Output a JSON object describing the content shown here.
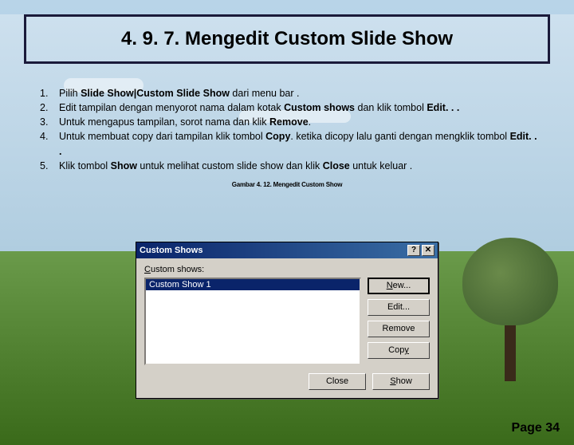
{
  "title": "4. 9. 7. Mengedit Custom Slide Show",
  "bullets": [
    {
      "num": "1.",
      "parts": [
        "Pilih ",
        "Slide Show|Custom Slide Show",
        " dari menu bar ."
      ]
    },
    {
      "num": "2.",
      "parts": [
        "Edit tampilan dengan menyorot nama dalam kotak ",
        "Custom shows",
        " dan klik tombol ",
        "Edit. . ."
      ]
    },
    {
      "num": "3.",
      "parts": [
        "Untuk mengapus tampilan, sorot nama dan klik ",
        "Remove",
        "."
      ]
    },
    {
      "num": "4.",
      "parts": [
        "Untuk membuat copy dari tampilan klik tombol ",
        "Copy",
        ". ketika dicopy lalu ganti dengan mengklik tombol ",
        "Edit. . ."
      ]
    },
    {
      "num": "5.",
      "parts": [
        "Klik tombol ",
        "Show",
        " untuk melihat custom slide show dan klik ",
        "Close",
        " untuk keluar ."
      ]
    }
  ],
  "caption": "Gambar 4. 12. Mengedit Custom Show",
  "dialog": {
    "title": "Custom Shows",
    "help": "?",
    "close": "✕",
    "label": "Custom shows:",
    "selected_item": "Custom Show 1",
    "buttons": {
      "new": "New...",
      "edit": "Edit...",
      "remove": "Remove",
      "copy": "Copy",
      "close_btn": "Close",
      "show": "Show"
    }
  },
  "page": "Page 34"
}
